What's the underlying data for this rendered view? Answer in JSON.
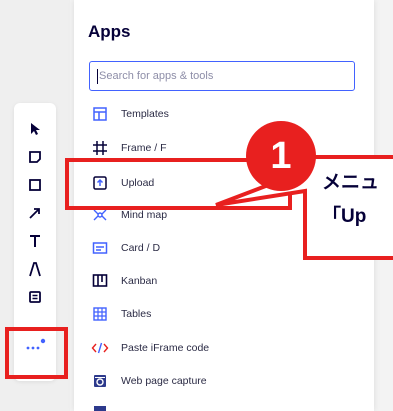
{
  "panel": {
    "title": "Apps",
    "search_placeholder": "Search for apps & tools",
    "items": [
      {
        "label": "Templates",
        "icon": "templates-icon"
      },
      {
        "label": "Frame / F",
        "icon": "frame-icon"
      },
      {
        "label": "Upload",
        "icon": "upload-icon"
      },
      {
        "label": "Mind map",
        "icon": "mind-map-icon"
      },
      {
        "label": "Card / D",
        "icon": "card-icon"
      },
      {
        "label": "Kanban",
        "icon": "kanban-icon"
      },
      {
        "label": "Tables",
        "icon": "tables-icon"
      },
      {
        "label": "Paste iFrame code",
        "icon": "code-icon"
      },
      {
        "label": "Web page capture",
        "icon": "web-capture-icon"
      }
    ]
  },
  "toolbar": {
    "tools": [
      "select-icon",
      "sticky-note-icon",
      "shape-icon",
      "pen-arrow-icon",
      "text-icon",
      "pen-icon",
      "comment-icon",
      "more-tools-icon"
    ]
  },
  "annotation": {
    "step_number": "1",
    "line1": "メニュ",
    "line2": "「Up",
    "color": "#e8201f"
  },
  "colors": {
    "accent": "#4262ff",
    "annotation_red": "#e8201f",
    "text": "#050038"
  }
}
